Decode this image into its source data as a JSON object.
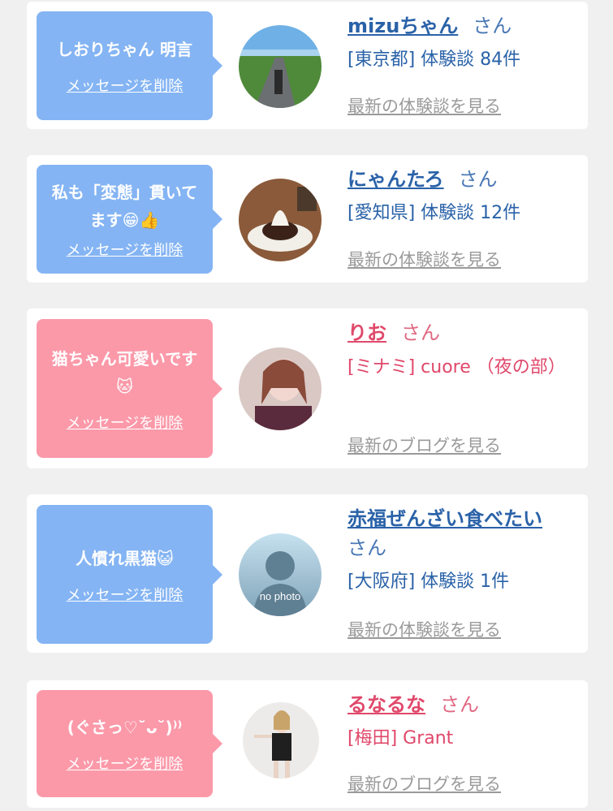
{
  "cards": [
    {
      "message": "しおりちゃん 明言",
      "delete_label": "メッセージを削除",
      "avatar_icon": "road-landscape-photo",
      "name": "mizuちゃん",
      "suffix": "さん",
      "detail": "[東京都] 体験談 84件",
      "latest_link": "最新の体験談を見る"
    },
    {
      "message": "私も「変態」貫いてます😁👍",
      "delete_label": "メッセージを削除",
      "avatar_icon": "dessert-photo",
      "name": "にゃんたろ",
      "suffix": "さん",
      "detail": "[愛知県] 体験談 12件",
      "latest_link": "最新の体験談を見る"
    },
    {
      "message": "猫ちゃん可愛いです🐱",
      "delete_label": "メッセージを削除",
      "avatar_icon": "girl-portrait-photo",
      "name": "りお",
      "suffix": "さん",
      "detail": "[ミナミ] cuore （夜の部）",
      "latest_link": "最新のブログを見る"
    },
    {
      "message": "人慣れ黒猫😺",
      "delete_label": "メッセージを削除",
      "avatar_icon": "no-photo-silhouette",
      "avatar_text": "no photo",
      "name": "赤福ぜんざい食べたい",
      "suffix": "さん",
      "detail": "[大阪府] 体験談 1件",
      "latest_link": "最新の体験談を見る"
    },
    {
      "message": "(ぐさっ♡˘ᴗ˘)⁾⁾",
      "delete_label": "メッセージを削除",
      "avatar_icon": "bunny-costume-photo",
      "name": "るなるな",
      "suffix": "さん",
      "detail": "[梅田] Grant",
      "latest_link": "最新のブログを見る"
    }
  ],
  "colors": {
    "background": "#f0f0f0",
    "bubble_blue": "#84b4f3",
    "bubble_pink": "#fb99a9",
    "name_blue": "#2a62a8",
    "name_pink": "#e0486a",
    "link_gray": "#9a9a9a"
  }
}
